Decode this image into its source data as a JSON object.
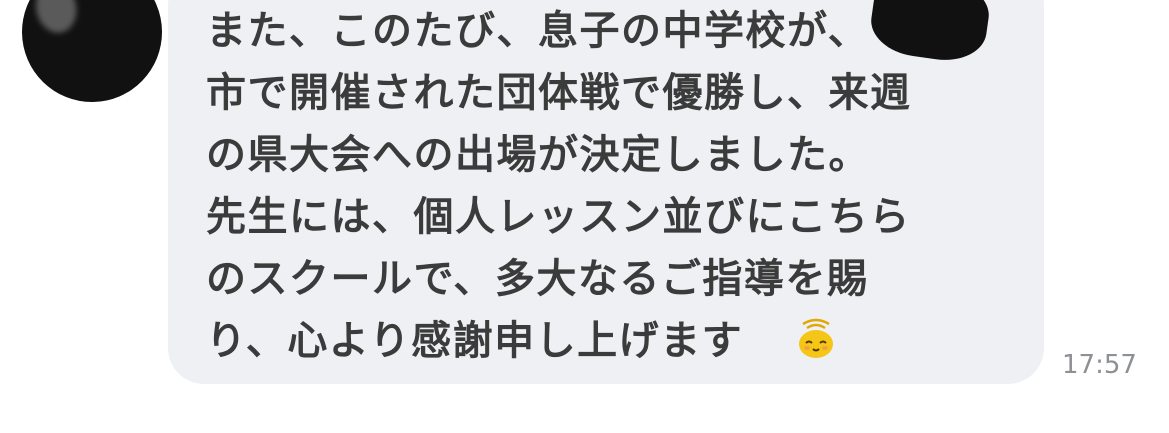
{
  "message": {
    "text": "また、このたび、息子の中学校が、\n市で開催された団体戦で優勝し、来週\nの県大会への出場が決定しました。\n先生には、個人レッスン並びにこちら\nのスクールで、多大なるご指導を賜\nり、心より感謝申し上げます",
    "emoji": "bowing-face-emoji",
    "time": "17:57"
  },
  "colors": {
    "bubble": "#eef0f3",
    "text": "#3b3b3b",
    "time": "#8d9094",
    "emoji": "#f5c518"
  }
}
